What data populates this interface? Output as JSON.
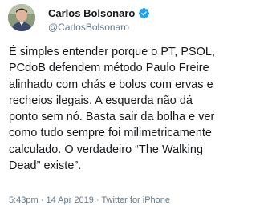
{
  "tweet": {
    "author": {
      "display_name": "Carlos Bolsonaro",
      "handle": "@CarlosBolsonaro",
      "verified": true,
      "verified_icon": "verified-badge-icon",
      "verified_color": "#1da1f2"
    },
    "text": "É simples entender porque o PT, PSOL,\nPCdoB defendem método Paulo Freire\nalinhado com chás e bolos com ervas e\nrecheios ilegais. A esquerda não dá\nponto sem nó. Basta sair da bolha e ver\ncomo tudo sempre foi milimetricamente\ncalculado. O verdadeiro “The Walking\nDead” existe”.",
    "time": "5:43pm",
    "date": "14 Apr 2019",
    "separator": "·",
    "source": "Twitter for iPhone"
  },
  "colors": {
    "text": "#14171a",
    "secondary_text": "#657786",
    "background": "#ffffff"
  }
}
